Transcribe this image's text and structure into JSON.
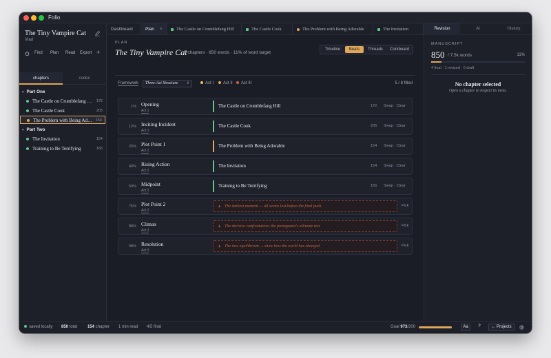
{
  "app": {
    "title": "Folio"
  },
  "sidebar": {
    "book_title": "The Tiny Vampire Cat",
    "author": "Vlad",
    "tools": [
      "Find",
      "Plan",
      "Read",
      "Export"
    ],
    "tabs": [
      "chapters",
      "codex"
    ],
    "parts": [
      {
        "name": "Part One",
        "chapters": [
          {
            "title": "The Castle on Crumblefang Hill",
            "words": "172",
            "status": "final"
          },
          {
            "title": "The Castle Cook",
            "words": "205",
            "status": "final"
          },
          {
            "title": "The Problem with Being Adorable",
            "words": "154",
            "status": "revised",
            "selected": true
          }
        ]
      },
      {
        "name": "Part Two",
        "chapters": [
          {
            "title": "The Invitation",
            "words": "154",
            "status": "final"
          },
          {
            "title": "Training to Be Terrifying",
            "words": "165",
            "status": "final"
          }
        ]
      }
    ]
  },
  "tabs": [
    {
      "label": "Dashboard"
    },
    {
      "label": "Plan",
      "active": true,
      "closable": true
    },
    {
      "label": "The Castle on Crumblefang Hill",
      "status": "final"
    },
    {
      "label": "The Castle Cook",
      "status": "final"
    },
    {
      "label": "The Problem with Being Adorable",
      "status": "revised"
    },
    {
      "label": "The Invitation",
      "status": "final"
    }
  ],
  "plan": {
    "kicker": "PLAN",
    "title": "The Tiny Vampire Cat",
    "meta": "5 chapters · 850 words · 11% of word target",
    "views": [
      "Timeline",
      "Beats",
      "Threads",
      "Corkboard"
    ],
    "active_view": "Beats",
    "framework_label": "Framework",
    "framework": "Three-Act Structure",
    "legend": [
      {
        "label": "Act I",
        "color": "#e3c36a"
      },
      {
        "label": "Act II",
        "color": "#e0a75a"
      },
      {
        "label": "Act III",
        "color": "#d2694a"
      }
    ],
    "filled": "5 / 8 filled",
    "swap_label": "Swap",
    "clear_label": "Clear",
    "pick_label": "Pick",
    "beats": [
      {
        "pct": "1%",
        "name": "Opening",
        "act": "Act 1",
        "chapter": "The Castle on Crumblefang Hill",
        "words": "172",
        "status": "final"
      },
      {
        "pct": "12%",
        "name": "Inciting Incident",
        "act": "Act 1",
        "chapter": "The Castle Cook",
        "words": "205",
        "status": "final"
      },
      {
        "pct": "25%",
        "name": "Plot Point 1",
        "act": "Act 1",
        "chapter": "The Problem with Being Adorable",
        "words": "154",
        "status": "revised"
      },
      {
        "pct": "40%",
        "name": "Rising Action",
        "act": "Act 2",
        "chapter": "The Invitation",
        "words": "154",
        "status": "final"
      },
      {
        "pct": "50%",
        "name": "Midpoint",
        "act": "Act 2",
        "chapter": "Training to Be Terrifying",
        "words": "165",
        "status": "final"
      },
      {
        "pct": "75%",
        "name": "Plot Point 2",
        "act": "Act 2",
        "prompt": "The darkest moment — all seems lost before the final push."
      },
      {
        "pct": "88%",
        "name": "Climax",
        "act": "Act 3",
        "prompt": "The decisive confrontation; the protagonist's ultimate test."
      },
      {
        "pct": "98%",
        "name": "Resolution",
        "act": "Act 3",
        "prompt": "The new equilibrium — show how the world has changed."
      }
    ]
  },
  "right_panel": {
    "tabs": [
      "Revision",
      "AI",
      "History"
    ],
    "manuscript_label": "MANUSCRIPT",
    "count": "850",
    "of": "/ 7.5k words",
    "pct": "11%",
    "progress": 0.113,
    "sub": "4 final · 1 revised · 0 draft",
    "no_chapter": "No chapter selected",
    "no_chapter_sub": "Open a chapter to inspect its meta."
  },
  "status": {
    "saved": "saved locally",
    "total_num": "850",
    "total_label": "total",
    "chapter_num": "154",
    "chapter_label": "chapter",
    "read": "1 min read",
    "final": "4/5 final",
    "goal_label": "Goal",
    "goal_done": "973",
    "goal_target": "/200",
    "goal_progress": 1,
    "aa": "Aa",
    "help": "?",
    "projects": "← Projects"
  },
  "colors": {
    "final": "#5ec98c",
    "revised": "#e0a75a",
    "accent": "#e0a75a"
  }
}
